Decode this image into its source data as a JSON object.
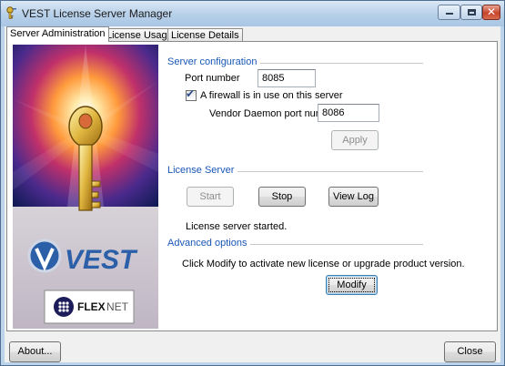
{
  "window": {
    "title": "VEST License Server Manager",
    "icon": "key-icon",
    "controls": {
      "minimize": "minimize-icon",
      "maximize": "maximize-icon",
      "close": "✕"
    }
  },
  "tabs": [
    {
      "label": "Server Administration",
      "active": true
    },
    {
      "label": "License Usage",
      "active": false
    },
    {
      "label": "License Details",
      "active": false
    }
  ],
  "branding": {
    "vest_logo_text": "VEST",
    "flexnet_text_bold": "FLEX",
    "flexnet_text_light": "NET"
  },
  "server_config": {
    "group_title": "Server configuration",
    "port_label": "Port number",
    "port_value": "8085",
    "firewall_label": "A firewall is in use on this server",
    "firewall_checked": true,
    "vendor_port_label": "Vendor Daemon port number",
    "vendor_port_value": "8086",
    "apply_label": "Apply"
  },
  "license_server": {
    "group_title": "License Server",
    "start_label": "Start",
    "stop_label": "Stop",
    "viewlog_label": "View Log",
    "status_text": "License server started."
  },
  "advanced": {
    "group_title": "Advanced options",
    "description": "Click Modify to activate new license or upgrade product version.",
    "modify_label": "Modify"
  },
  "footer": {
    "about_label": "About...",
    "close_label": "Close"
  },
  "colors": {
    "group_title": "#1a57b6",
    "panel_bg": "#ffffff",
    "window_bg": "#f0f0f0"
  }
}
